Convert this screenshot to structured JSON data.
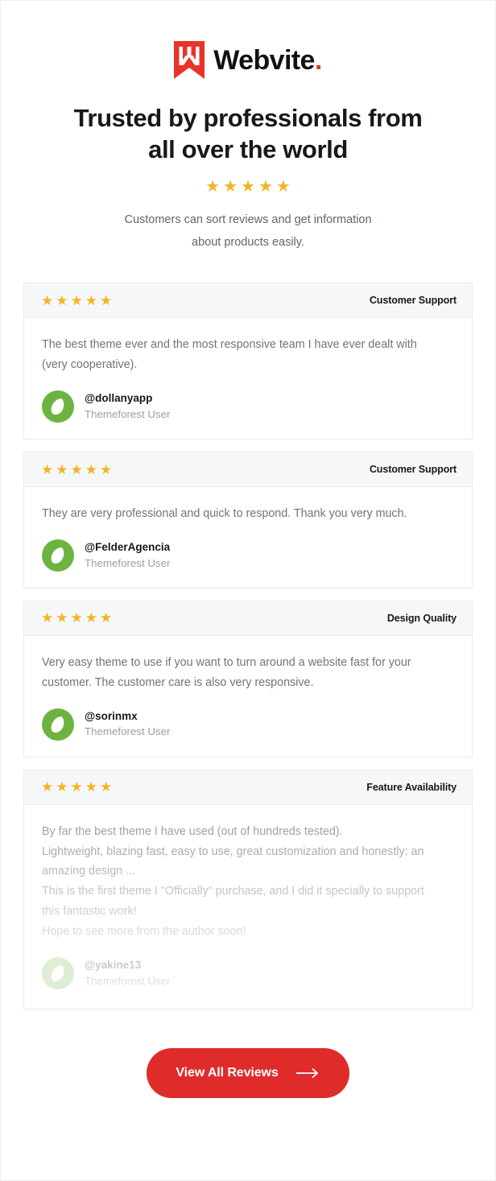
{
  "brand": {
    "name": "Webvite",
    "dot": ".",
    "logo_icon": "webvite-bookmark-icon",
    "logo_color": "#e8332a",
    "wordmark_color": "#121212"
  },
  "header": {
    "headline_line1": "Trusted by professionals from",
    "headline_line2": "all over the world",
    "rating_stars": 5,
    "star_glyph": "★",
    "star_color": "#f5b324",
    "subtitle_line1": "Customers can sort reviews and get information",
    "subtitle_line2": "about products easily."
  },
  "reviews": [
    {
      "stars": 5,
      "tag": "Customer Support",
      "lines": [
        "The best theme ever and the most responsive team I have ever dealt with",
        "(very cooperative)."
      ],
      "handle": "@dollanyapp",
      "role": "Themeforest User",
      "avatar_icon": "envato-leaf-avatar",
      "avatar_color": "#6cb33f",
      "faded": false
    },
    {
      "stars": 5,
      "tag": "Customer Support",
      "lines": [
        "They are very professional and quick to respond. Thank you very much."
      ],
      "handle": "@FelderAgencia",
      "role": "Themeforest User",
      "avatar_icon": "envato-leaf-avatar",
      "avatar_color": "#6cb33f",
      "faded": false
    },
    {
      "stars": 5,
      "tag": "Design Quality",
      "lines": [
        "Very easy theme to use if you want to turn around a website fast for your",
        "customer. The customer care is also very responsive."
      ],
      "handle": "@sorinmx",
      "role": "Themeforest User",
      "avatar_icon": "envato-leaf-avatar",
      "avatar_color": "#6cb33f",
      "faded": false
    },
    {
      "stars": 5,
      "tag": "Feature Availability",
      "lines": [
        "By far the best theme I have used (out of hundreds tested).",
        "Lightweight, blazing fast, easy to use, great customization and honestly: an",
        "amazing design ...",
        "This is the first theme I \"Officially\" purchase, and I did it specially to support",
        "this fantastic work!",
        "Hope to see more from the author soon!"
      ],
      "handle": "@yakine13",
      "role": "Themeforest User",
      "avatar_icon": "envato-leaf-avatar",
      "avatar_color": "#6cb33f",
      "faded": true
    }
  ],
  "cta": {
    "label": "View All Reviews",
    "icon": "arrow-right-icon",
    "background": "#e02b2b",
    "text_color": "#ffffff"
  }
}
